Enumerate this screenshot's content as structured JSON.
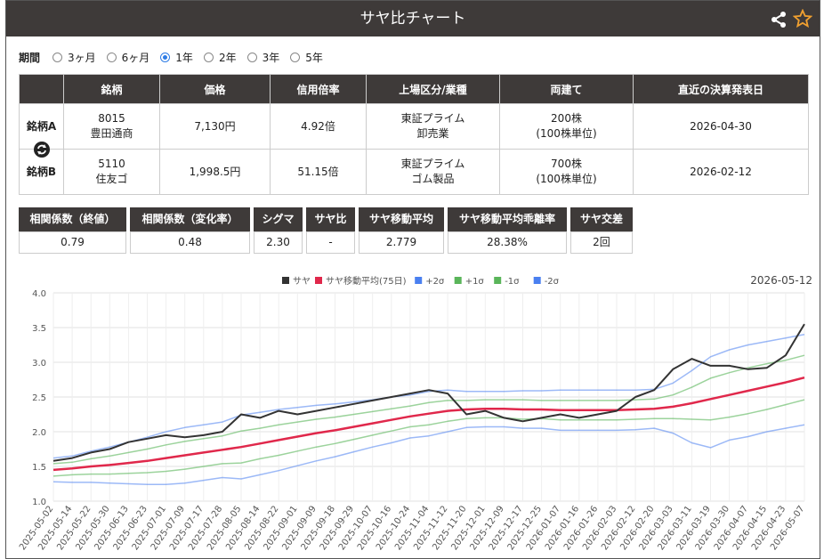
{
  "title": "サヤ比チャート",
  "icons": {
    "share": "share-icon",
    "favorite": "star-icon"
  },
  "period": {
    "label": "期間",
    "options": [
      "3ヶ月",
      "6ヶ月",
      "1年",
      "2年",
      "3年",
      "5年"
    ],
    "selected": "1年"
  },
  "table": {
    "headers": [
      "銘柄",
      "価格",
      "信用倍率",
      "上場区分/業種",
      "両建て",
      "直近の決算発表日"
    ],
    "rows": [
      {
        "label": "銘柄A",
        "code": "8015",
        "name": "豊田通商",
        "price": "7,130円",
        "ratio": "4.92倍",
        "market": "東証プライム",
        "sector": "卸売業",
        "shares": "200株",
        "unit": "(100株単位)",
        "date": "2026-04-30"
      },
      {
        "label": "銘柄B",
        "code": "5110",
        "name": "住友ゴ",
        "price": "1,998.5円",
        "ratio": "51.15倍",
        "market": "東証プライム",
        "sector": "ゴム製品",
        "shares": "700株",
        "unit": "(100株単位)",
        "date": "2026-02-12"
      }
    ]
  },
  "metrics": [
    {
      "label": "相関係数（終値）",
      "value": "0.79"
    },
    {
      "label": "相関係数（変化率）",
      "value": "0.48"
    },
    {
      "label": "シグマ",
      "value": "2.30"
    },
    {
      "label": "サヤ比",
      "value": "-"
    },
    {
      "label": "サヤ移動平均",
      "value": "2.779"
    },
    {
      "label": "サヤ移動平均乖離率",
      "value": "28.38%"
    },
    {
      "label": "サヤ交差",
      "value": "2回"
    }
  ],
  "chart_data": {
    "type": "line",
    "date_label": "2026-05-12",
    "ylim": [
      1.0,
      4.0
    ],
    "yticks": [
      "1.0",
      "1.5",
      "2.0",
      "2.5",
      "3.0",
      "3.5",
      "4.0"
    ],
    "xticks": [
      "2025-05-02",
      "2025-05-14",
      "2025-05-22",
      "2025-05-30",
      "2025-06-13",
      "2025-06-23",
      "2025-07-01",
      "2025-07-09",
      "2025-07-17",
      "2025-07-28",
      "2025-08-05",
      "2025-08-14",
      "2025-08-22",
      "2025-09-01",
      "2025-09-09",
      "2025-09-18",
      "2025-09-29",
      "2025-10-07",
      "2025-10-16",
      "2025-10-24",
      "2025-11-04",
      "2025-11-12",
      "2025-11-20",
      "2025-12-01",
      "2025-12-09",
      "2025-12-17",
      "2025-12-25",
      "2026-01-07",
      "2026-01-16",
      "2026-01-26",
      "2026-02-03",
      "2026-02-12",
      "2026-02-20",
      "2026-03-03",
      "2026-03-11",
      "2026-03-19",
      "2026-03-30",
      "2026-04-07",
      "2026-04-15",
      "2026-04-23",
      "2026-05-07"
    ],
    "series": [
      {
        "name": "サヤ",
        "color": "#333333",
        "values": [
          1.58,
          1.62,
          1.7,
          1.75,
          1.85,
          1.9,
          1.95,
          1.92,
          1.95,
          2.0,
          2.25,
          2.2,
          2.3,
          2.25,
          2.3,
          2.35,
          2.4,
          2.45,
          2.5,
          2.55,
          2.6,
          2.55,
          2.25,
          2.3,
          2.2,
          2.15,
          2.2,
          2.25,
          2.2,
          2.25,
          2.3,
          2.5,
          2.6,
          2.9,
          3.05,
          2.95,
          2.95,
          2.9,
          2.92,
          3.1,
          3.55
        ]
      },
      {
        "name": "サヤ移動平均(75日)",
        "color": "#e0284b",
        "values": [
          1.45,
          1.47,
          1.5,
          1.52,
          1.55,
          1.58,
          1.62,
          1.66,
          1.7,
          1.74,
          1.78,
          1.83,
          1.88,
          1.93,
          1.98,
          2.02,
          2.07,
          2.12,
          2.17,
          2.22,
          2.26,
          2.3,
          2.32,
          2.33,
          2.33,
          2.32,
          2.32,
          2.31,
          2.31,
          2.31,
          2.31,
          2.32,
          2.33,
          2.36,
          2.41,
          2.47,
          2.53,
          2.59,
          2.65,
          2.71,
          2.78
        ]
      },
      {
        "name": "+2σ",
        "color": "#4a80f0",
        "values": [
          1.62,
          1.65,
          1.72,
          1.78,
          1.85,
          1.92,
          2.0,
          2.06,
          2.1,
          2.14,
          2.24,
          2.28,
          2.32,
          2.35,
          2.38,
          2.4,
          2.43,
          2.46,
          2.5,
          2.53,
          2.58,
          2.6,
          2.58,
          2.58,
          2.58,
          2.59,
          2.59,
          2.6,
          2.6,
          2.6,
          2.6,
          2.6,
          2.61,
          2.7,
          2.88,
          3.08,
          3.18,
          3.25,
          3.3,
          3.35,
          3.4
        ]
      },
      {
        "name": "+1σ",
        "color": "#5ab55a",
        "values": [
          1.54,
          1.56,
          1.61,
          1.65,
          1.7,
          1.75,
          1.81,
          1.86,
          1.9,
          1.94,
          2.01,
          2.05,
          2.1,
          2.14,
          2.18,
          2.21,
          2.25,
          2.29,
          2.33,
          2.37,
          2.42,
          2.45,
          2.45,
          2.46,
          2.46,
          2.46,
          2.45,
          2.45,
          2.45,
          2.45,
          2.45,
          2.46,
          2.47,
          2.53,
          2.64,
          2.77,
          2.85,
          2.92,
          2.98,
          3.03,
          3.1
        ]
      },
      {
        "name": "-1σ",
        "color": "#5ab55a",
        "values": [
          1.36,
          1.38,
          1.39,
          1.39,
          1.4,
          1.41,
          1.43,
          1.46,
          1.5,
          1.54,
          1.55,
          1.61,
          1.66,
          1.72,
          1.78,
          1.83,
          1.89,
          1.95,
          2.01,
          2.07,
          2.1,
          2.15,
          2.19,
          2.2,
          2.2,
          2.18,
          2.19,
          2.17,
          2.17,
          2.17,
          2.17,
          2.18,
          2.19,
          2.19,
          2.18,
          2.17,
          2.21,
          2.26,
          2.32,
          2.39,
          2.46
        ]
      },
      {
        "name": "-2σ",
        "color": "#4a80f0",
        "values": [
          1.28,
          1.27,
          1.27,
          1.26,
          1.25,
          1.24,
          1.24,
          1.26,
          1.3,
          1.34,
          1.32,
          1.38,
          1.44,
          1.51,
          1.58,
          1.64,
          1.71,
          1.78,
          1.84,
          1.91,
          1.94,
          2.0,
          2.06,
          2.07,
          2.07,
          2.05,
          2.05,
          2.02,
          2.02,
          2.02,
          2.02,
          2.03,
          2.05,
          1.98,
          1.84,
          1.77,
          1.88,
          1.93,
          2.0,
          2.05,
          2.1
        ]
      }
    ]
  }
}
